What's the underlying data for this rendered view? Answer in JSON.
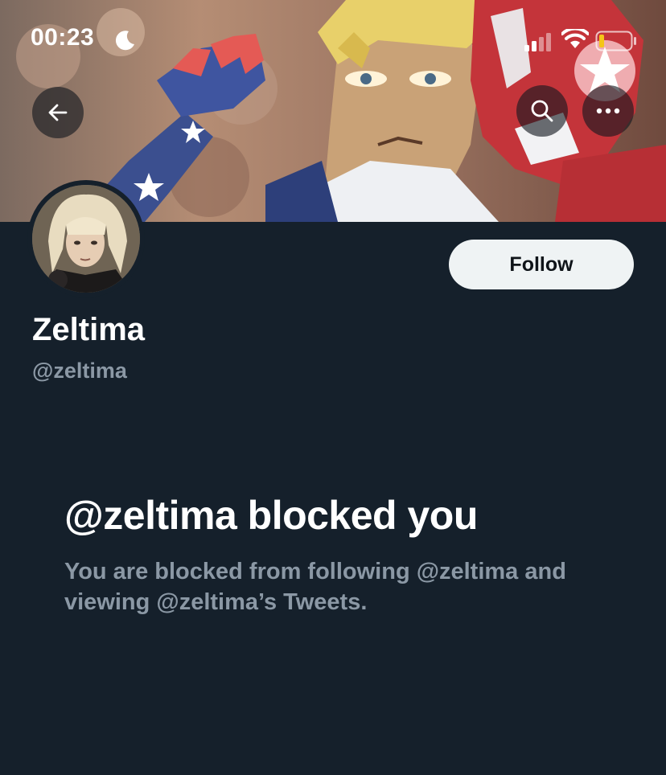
{
  "status_bar": {
    "time": "00:23",
    "icons": [
      "moon-icon",
      "cellular-signal-icon",
      "wifi-icon",
      "battery-icon"
    ]
  },
  "header": {
    "back_icon": "arrow-left-icon",
    "search_icon": "search-icon",
    "more_icon": "more-horizontal-icon"
  },
  "profile": {
    "display_name": "Zeltima",
    "handle": "@zeltima",
    "follow_label": "Follow"
  },
  "blocked": {
    "title": "@zeltima blocked you",
    "description": "You are blocked from following @zeltima and viewing @zeltima’s Tweets."
  },
  "colors": {
    "background": "#15202b",
    "primary_text": "#ffffff",
    "secondary_text": "#8b98a5",
    "button_bg": "#eff3f4",
    "button_text": "#0f1419",
    "battery_level": "#f5c518"
  }
}
